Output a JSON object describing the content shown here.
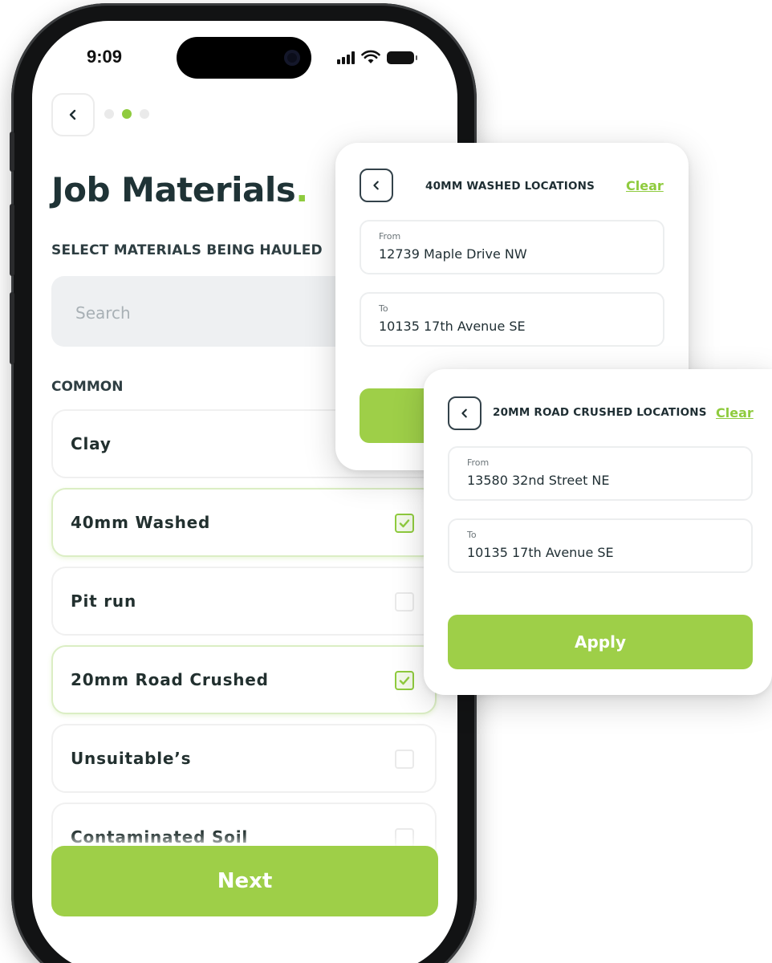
{
  "status_bar": {
    "time": "9:09"
  },
  "onboarding": {
    "steps": 3,
    "active_step": 2
  },
  "page": {
    "title": "Job Materials",
    "title_accent": ".",
    "subtitle": "SELECT MATERIALS BEING HAULED",
    "search_placeholder": "Search",
    "section_label": "COMMON",
    "next_label": "Next"
  },
  "materials": [
    {
      "label": "Clay",
      "checked": false
    },
    {
      "label": "40mm Washed",
      "checked": true
    },
    {
      "label": "Pit run",
      "checked": false
    },
    {
      "label": "20mm Road Crushed",
      "checked": true
    },
    {
      "label": "Unsuitable’s",
      "checked": false
    },
    {
      "label": "Contaminated Soil",
      "checked": false
    }
  ],
  "location_cards": [
    {
      "title": "40MM WASHED LOCATIONS",
      "clear_label": "Clear",
      "from_label": "From",
      "from_value": "12739 Maple Drive NW",
      "to_label": "To",
      "to_value": "10135 17th Avenue SE"
    },
    {
      "title": "20MM ROAD CRUSHED LOCATIONS",
      "clear_label": "Clear",
      "from_label": "From",
      "from_value": "13580 32nd Street NE",
      "to_label": "To",
      "to_value": "10135 17th Avenue SE",
      "apply_label": "Apply"
    }
  ],
  "colors": {
    "accent": "#8fcb3e",
    "button": "#9ecf48",
    "title": "#1f3336"
  }
}
